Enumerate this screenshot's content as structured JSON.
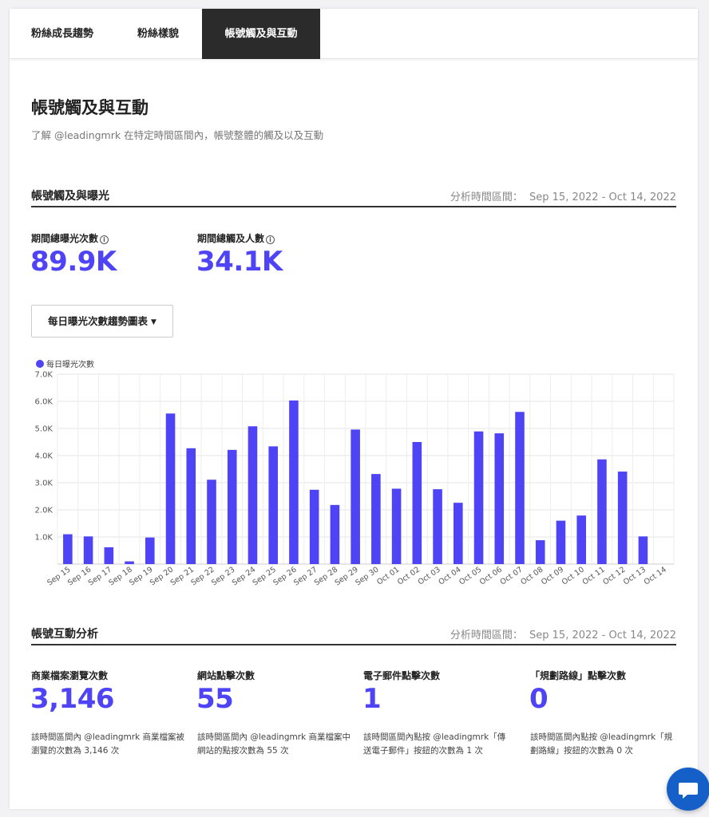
{
  "tabs": [
    {
      "label": "粉絲成長趨勢"
    },
    {
      "label": "粉絲樣貌"
    },
    {
      "label": "帳號觸及與互動"
    }
  ],
  "page": {
    "title": "帳號觸及與互動",
    "description": "了解 @leadingmrk 在特定時間區間內，帳號整體的觸及以及互動"
  },
  "reach_section": {
    "title": "帳號觸及與曝光",
    "range_label": "分析時間區間：",
    "range_value": "Sep 15, 2022 - Oct 14, 2022",
    "metrics": [
      {
        "label": "期間總曝光次數",
        "value": "89.9K"
      },
      {
        "label": "期間總觸及人數",
        "value": "34.1K"
      }
    ],
    "dropdown_label": "每日曝光次數趨勢圖表"
  },
  "chart_data": {
    "type": "bar",
    "categories": [
      "Sep 15",
      "Sep 16",
      "Sep 17",
      "Sep 18",
      "Sep 19",
      "Sep 20",
      "Sep 21",
      "Sep 22",
      "Sep 23",
      "Sep 24",
      "Sep 25",
      "Sep 26",
      "Sep 27",
      "Sep 28",
      "Sep 29",
      "Sep 30",
      "Oct 01",
      "Oct 02",
      "Oct 03",
      "Oct 04",
      "Oct 05",
      "Oct 06",
      "Oct 07",
      "Oct 08",
      "Oct 09",
      "Oct 10",
      "Oct 11",
      "Oct 12",
      "Oct 13",
      "Oct 14"
    ],
    "series": [
      {
        "name": "每日曝光次數",
        "values": [
          1100,
          1020,
          620,
          100,
          980,
          5550,
          4270,
          3110,
          4210,
          5080,
          4340,
          6030,
          2740,
          2180,
          4960,
          3320,
          2780,
          4500,
          2760,
          2260,
          4890,
          4820,
          5610,
          880,
          1600,
          1790,
          3860,
          3410,
          1020,
          0
        ]
      }
    ],
    "ylim": [
      0,
      7000
    ],
    "yticks": [
      "1.0K",
      "2.0K",
      "3.0K",
      "4.0K",
      "5.0K",
      "6.0K",
      "7.0K"
    ],
    "ytick_values": [
      1000,
      2000,
      3000,
      4000,
      5000,
      6000,
      7000
    ],
    "xlabel": "",
    "ylabel": "",
    "grid": true,
    "legend": "top-left",
    "color": "#4e44f5"
  },
  "engagement_section": {
    "title": "帳號互動分析",
    "range_label": "分析時間區間：",
    "range_value": "Sep 15, 2022 - Oct 14, 2022",
    "metrics": [
      {
        "label": "商業檔案瀏覽次數",
        "value": "3,146",
        "desc": "該時間區間內 @leadingmrk 商業檔案被瀏覽的次數為 3,146 次"
      },
      {
        "label": "網站點擊次數",
        "value": "55",
        "desc": "該時間區間內 @leadingmrk 商業檔案中網站的點按次數為 55 次"
      },
      {
        "label": "電子郵件點擊次數",
        "value": "1",
        "desc": "該時間區間內點按 @leadingmrk「傳送電子郵件」按鈕的次數為 1 次"
      },
      {
        "label": "「規劃路線」點擊次數",
        "value": "0",
        "desc": "該時間區間內點按 @leadingmrk「規劃路線」按鈕的次數為 0 次"
      }
    ]
  },
  "colors": {
    "accent": "#4e44f5",
    "active_tab": "#2b2b2b",
    "chat": "#1560c8"
  },
  "icons": {
    "info": "info-icon",
    "caret": "caret-down-icon",
    "chat": "chat-bubble-icon"
  }
}
